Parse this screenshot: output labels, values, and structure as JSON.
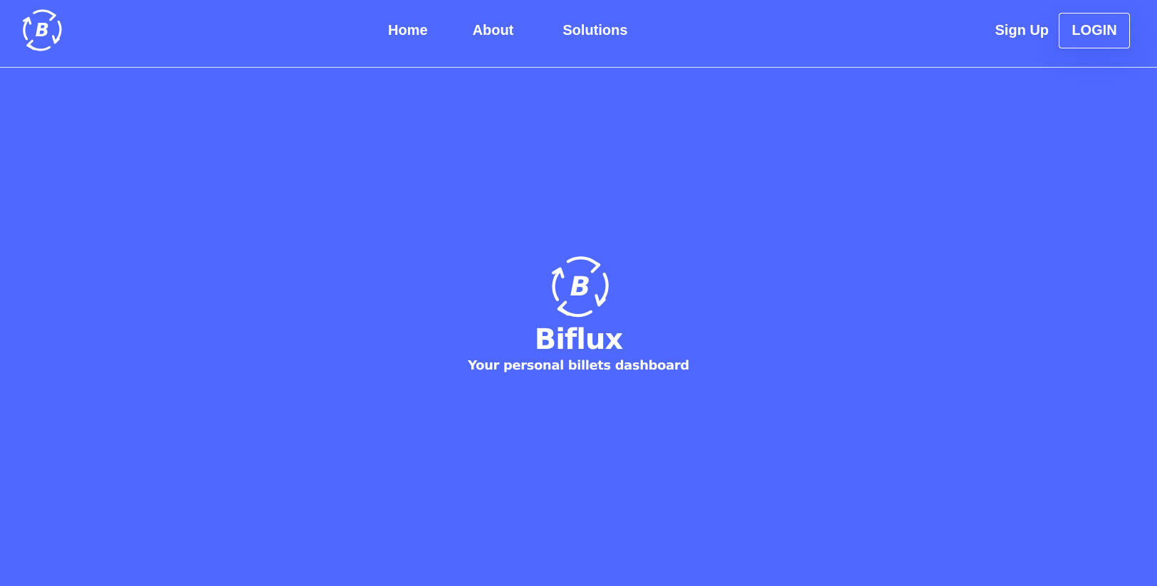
{
  "header": {
    "logo": {
      "icon": "biflux-logo-icon",
      "letter": "B"
    },
    "nav": [
      {
        "label": "Home"
      },
      {
        "label": "About"
      },
      {
        "label": "Solutions"
      }
    ],
    "signup_label": "Sign Up",
    "login_label": "LOGIN"
  },
  "hero": {
    "logo": {
      "icon": "biflux-logo-icon",
      "letter": "B"
    },
    "title": "Biflux",
    "tagline": "Your personal billets dashboard"
  },
  "colors": {
    "background": "#4f68ff",
    "foreground": "#ffffff"
  }
}
